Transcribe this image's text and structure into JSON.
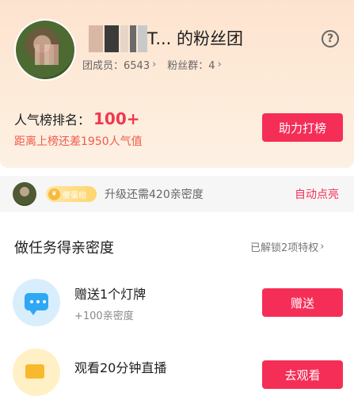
{
  "header": {
    "fan_club_title": "T... 的粉丝团",
    "members_label": "团成员：6543",
    "groups_label": "粉丝群：4",
    "rank_label": "人气榜排名：",
    "rank_value": "100+",
    "rank_gap_text": "距离上榜还差1950人气值",
    "help_button_label": "助力打榜",
    "help_icon": "?"
  },
  "intimacy": {
    "level_badge_text": "傻蛋组",
    "upgrade_text": "升级还需420亲密度",
    "auto_light_label": "自动点亮"
  },
  "tasks": {
    "section_title": "做任务得亲密度",
    "unlocked_text": "已解锁2项特权",
    "items": [
      {
        "name": "赠送1个灯牌",
        "reward": "+100亲密度",
        "button": "赠送",
        "icon": "message-icon"
      },
      {
        "name": "观看20分钟直播",
        "reward": "",
        "button": "去观看",
        "icon": "live-icon"
      }
    ]
  },
  "colors": {
    "accent": "#f52e57",
    "header_gradient_top": "#fde3cf",
    "rank_red": "#f0384f"
  }
}
